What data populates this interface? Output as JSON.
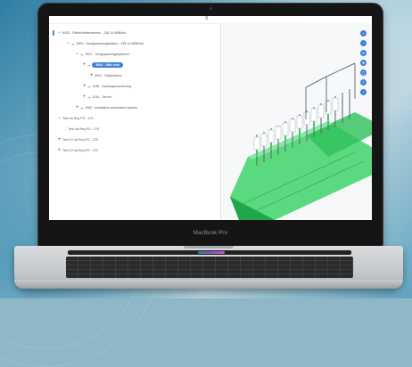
{
  "laptop": {
    "brand_label": "MacBook Pro"
  },
  "app": {
    "close_icon": "x",
    "tree": [
      {
        "toggle": "−",
        "label": "6435 - Elektriciteitsnetwerk - 138 14 MilBlind"
      },
      {
        "toggle": "−",
        "label": "3900 - Hoogspanningsstation - 138 14 MilBvind"
      },
      {
        "toggle": "−",
        "label": "3921 - Hoogspanningssysteem"
      },
      {
        "toggle": "+",
        "label": "3923 - 0NN veld",
        "selected": true
      },
      {
        "toggle": "+",
        "label": "3924 - Railsysteem"
      },
      {
        "toggle": "+",
        "label": "1236 - Aardingsvoorziening"
      },
      {
        "toggle": "+",
        "label": "1244 - Terrein"
      },
      {
        "toggle": "+",
        "label": "4980 - substation automation system"
      },
      {
        "toggle": "−",
        "label": "Test 4a Req PO - 173"
      },
      {
        "toggle": "",
        "label": "Test 4a Req PO - 270"
      },
      {
        "toggle": "+",
        "label": "Test 1V 4a Req PO - 273"
      },
      {
        "toggle": "+",
        "label": "Test 1V 4a Req PO - 272"
      }
    ],
    "view_controls": [
      "zoom-in-icon",
      "zoom-out-icon",
      "rotate-icon",
      "pan-icon",
      "fit-icon",
      "layers-icon",
      "info-icon"
    ],
    "colors": {
      "accent": "#3d7fd9",
      "ground": "#2ecc55"
    }
  }
}
